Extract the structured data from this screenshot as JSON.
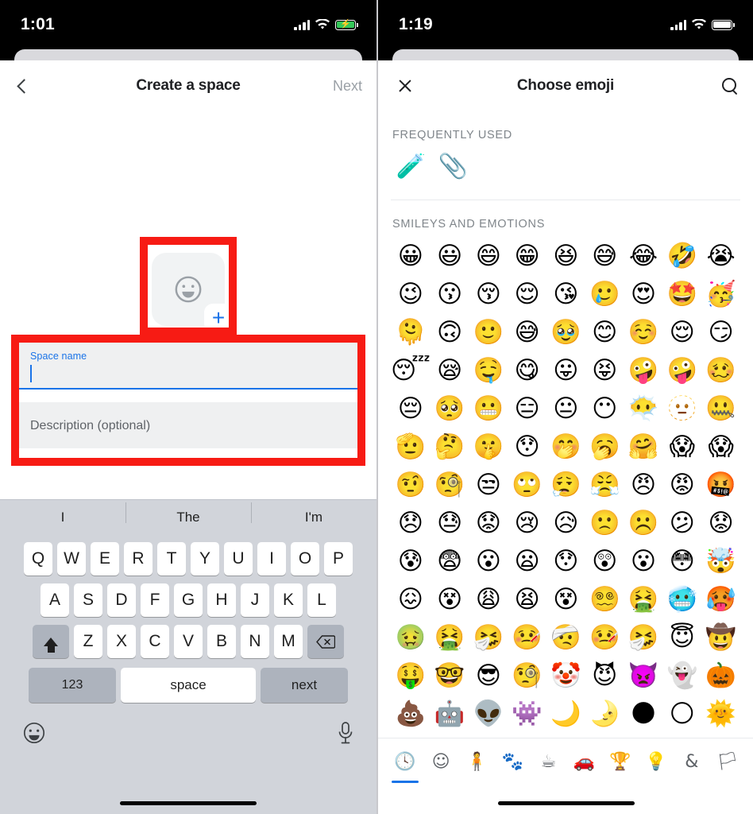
{
  "left": {
    "status": {
      "time": "1:01",
      "signal_icon": "cellular-bars-icon",
      "wifi_icon": "wifi-icon",
      "battery_icon": "battery-charging-icon"
    },
    "nav": {
      "back_icon": "back-chevron-icon",
      "title": "Create a space",
      "next_label": "Next"
    },
    "avatar": {
      "icon": "smiley-outline-icon",
      "add_icon": "plus-icon",
      "add_label": "+"
    },
    "form": {
      "name_label": "Space name",
      "name_value": "",
      "description_placeholder": "Description (optional)"
    },
    "keyboard": {
      "predictions": [
        "I",
        "The",
        "I'm"
      ],
      "row1": [
        "Q",
        "W",
        "E",
        "R",
        "T",
        "Y",
        "U",
        "I",
        "O",
        "P"
      ],
      "row2": [
        "A",
        "S",
        "D",
        "F",
        "G",
        "H",
        "J",
        "K",
        "L"
      ],
      "row3": [
        "Z",
        "X",
        "C",
        "V",
        "B",
        "N",
        "M"
      ],
      "shift_icon": "shift-arrow-icon",
      "backspace_icon": "backspace-icon",
      "numbers_label": "123",
      "space_label": "space",
      "next_label": "next",
      "emoji_icon": "emoji-keyboard-icon",
      "mic_icon": "microphone-icon"
    }
  },
  "right": {
    "status": {
      "time": "1:19",
      "signal_icon": "cellular-bars-icon",
      "wifi_icon": "wifi-icon",
      "battery_icon": "battery-icon"
    },
    "nav": {
      "close_icon": "close-x-icon",
      "title": "Choose emoji",
      "search_icon": "search-icon"
    },
    "sections": [
      {
        "label": "FREQUENTLY USED",
        "emojis": [
          "🧪",
          "📎"
        ]
      },
      {
        "label": "SMILEYS AND EMOTIONS",
        "emojis": [
          "😀",
          "😃",
          "😄",
          "😁",
          "😆",
          "😅",
          "😂",
          "🤣",
          "😭",
          "😉",
          "😗",
          "😚",
          "😌",
          "😘",
          "🥲",
          "😍",
          "🤩",
          "🥳",
          "🫠",
          "🙃",
          "🙂",
          "😅",
          "🥹",
          "😊",
          "☺️",
          "😌",
          "😏",
          "😴",
          "😪",
          "🤤",
          "😋",
          "😛",
          "😝",
          "🤪",
          "🤪",
          "🥴",
          "😔",
          "🥺",
          "😬",
          "😑",
          "😐",
          "😶",
          "😶‍🌫️",
          "🫥",
          "🤐",
          "🫡",
          "🤔",
          "🤫",
          "😯",
          "🤭",
          "🥱",
          "🤗",
          "😱",
          "😱",
          "🤨",
          "🧐",
          "😒",
          "🙄",
          "😮‍💨",
          "😤",
          "😠",
          "😡",
          "🤬",
          "😞",
          "😓",
          "😟",
          "😢",
          "😥",
          "🙁",
          "☹️",
          "😕",
          "😟",
          "😰",
          "😨",
          "😮",
          "😦",
          "😯",
          "😲",
          "😮",
          "😳",
          "🤯",
          "😖",
          "😵",
          "😩",
          "😫",
          "😵",
          "😵‍💫",
          "🤮",
          "🥶",
          "🥵",
          "🤢",
          "🤮",
          "🤧",
          "🤒",
          "🤕",
          "🤒",
          "🤧",
          "😇",
          "🤠",
          "🤑",
          "🤓",
          "😎",
          "🧐",
          "🤡",
          "😈",
          "👿",
          "👻",
          "🎃",
          "💩",
          "🤖",
          "👽",
          "👾",
          "🌙",
          "🌛",
          "🌑",
          "🌕",
          "🌞"
        ]
      }
    ],
    "tabs": [
      {
        "name": "recent-tab",
        "icon": "🕓",
        "label": "Recent",
        "active": true
      },
      {
        "name": "smileys-tab",
        "icon": "☺",
        "label": "Smileys",
        "active": false
      },
      {
        "name": "people-tab",
        "icon": "🧍",
        "label": "People",
        "active": false
      },
      {
        "name": "animals-tab",
        "icon": "🐾",
        "label": "Animals and nature",
        "active": false
      },
      {
        "name": "food-tab",
        "icon": "☕",
        "label": "Food and drink",
        "active": false
      },
      {
        "name": "travel-tab",
        "icon": "🚗",
        "label": "Travel and places",
        "active": false
      },
      {
        "name": "activities-tab",
        "icon": "🏆",
        "label": "Activities",
        "active": false
      },
      {
        "name": "objects-tab",
        "icon": "💡",
        "label": "Objects",
        "active": false
      },
      {
        "name": "symbols-tab",
        "icon": "&",
        "label": "Symbols",
        "active": false
      },
      {
        "name": "flags-tab",
        "icon": "🏳",
        "label": "Flags",
        "active": false
      }
    ]
  },
  "annotations": {
    "color": "#f71b14",
    "boxes": [
      "avatar-highlight",
      "fields-highlight"
    ]
  }
}
